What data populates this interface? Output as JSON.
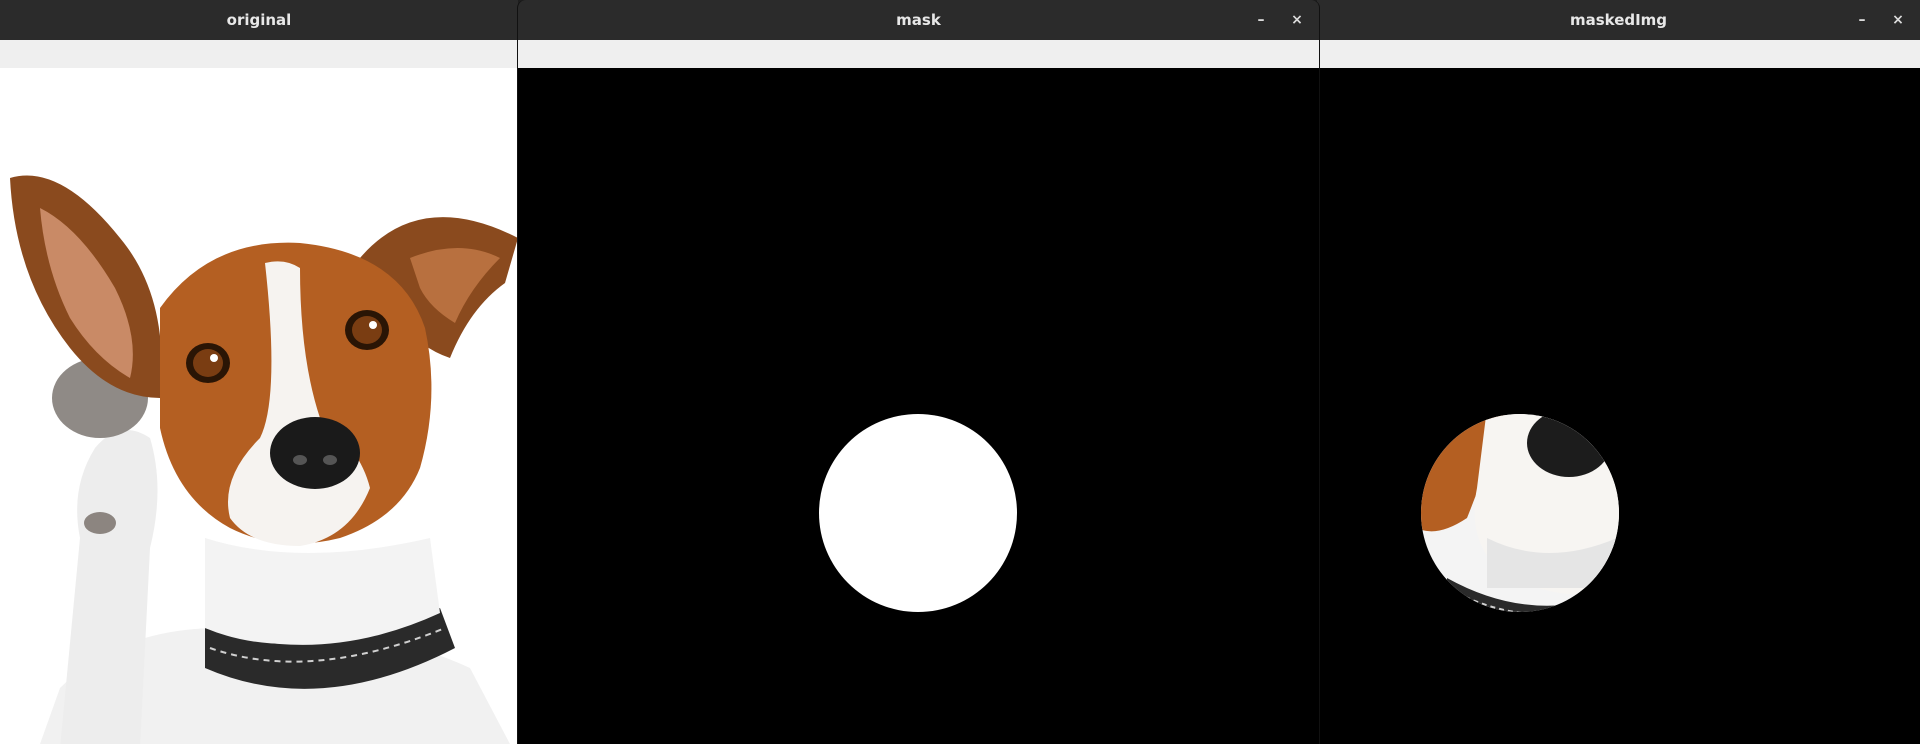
{
  "windows": {
    "original": {
      "title": "original"
    },
    "mask": {
      "title": "mask",
      "minimize_glyph": "–",
      "close_glyph": "×"
    },
    "masked": {
      "title": "maskedImg",
      "minimize_glyph": "–",
      "close_glyph": "×"
    }
  },
  "icons": [
    "minimize-icon",
    "close-icon"
  ],
  "colors": {
    "titlebar": "#2b2b2b",
    "toolbar": "#efefef",
    "mask_fill": "#ffffff",
    "background": "#000000"
  }
}
